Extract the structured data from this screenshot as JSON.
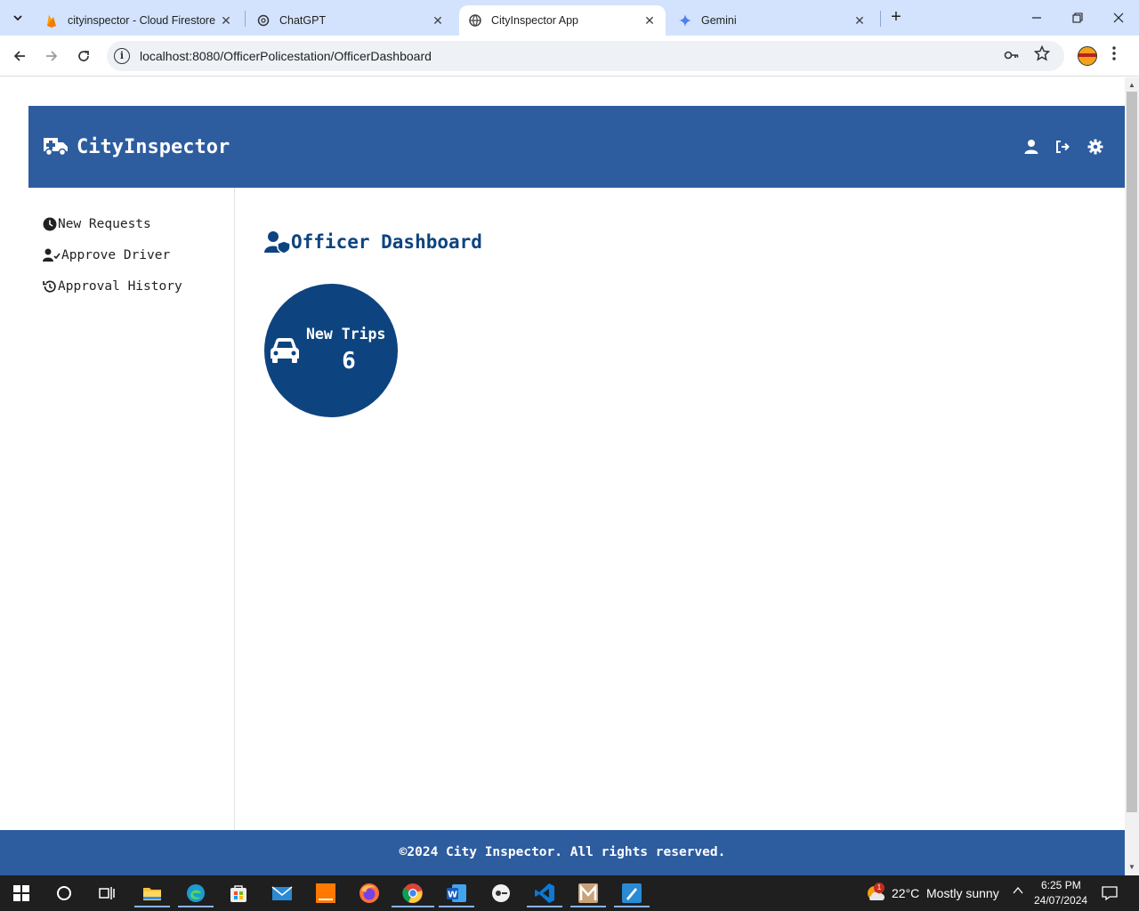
{
  "browser": {
    "tabs": [
      {
        "title": "cityinspector - Cloud Firestore",
        "close": "✕"
      },
      {
        "title": "ChatGPT",
        "close": "✕"
      },
      {
        "title": "CityInspector App",
        "close": "✕"
      },
      {
        "title": "Gemini",
        "close": "✕"
      }
    ],
    "url": "localhost:8080/OfficerPolicestation/OfficerDashboard"
  },
  "app": {
    "brand": "CityInspector",
    "header_icons": [
      "user-icon",
      "logout-icon",
      "settings-icon"
    ],
    "sidebar": {
      "items": [
        {
          "label": "New Requests",
          "icon": "clock-icon"
        },
        {
          "label": "Approve Driver",
          "icon": "user-check-icon"
        },
        {
          "label": "Approval History",
          "icon": "history-icon"
        }
      ]
    },
    "page_title": "Officer Dashboard",
    "card": {
      "label": "New Trips",
      "count": "6",
      "icon": "car-icon"
    },
    "footer": "©2024 City Inspector. All rights reserved.",
    "colors": {
      "header": "#2d5c9f",
      "accent": "#0d4480"
    }
  },
  "taskbar": {
    "weather": {
      "temp": "22°C",
      "condition": "Mostly sunny",
      "badge": "1"
    },
    "time": "6:25 PM",
    "date": "24/07/2024"
  }
}
